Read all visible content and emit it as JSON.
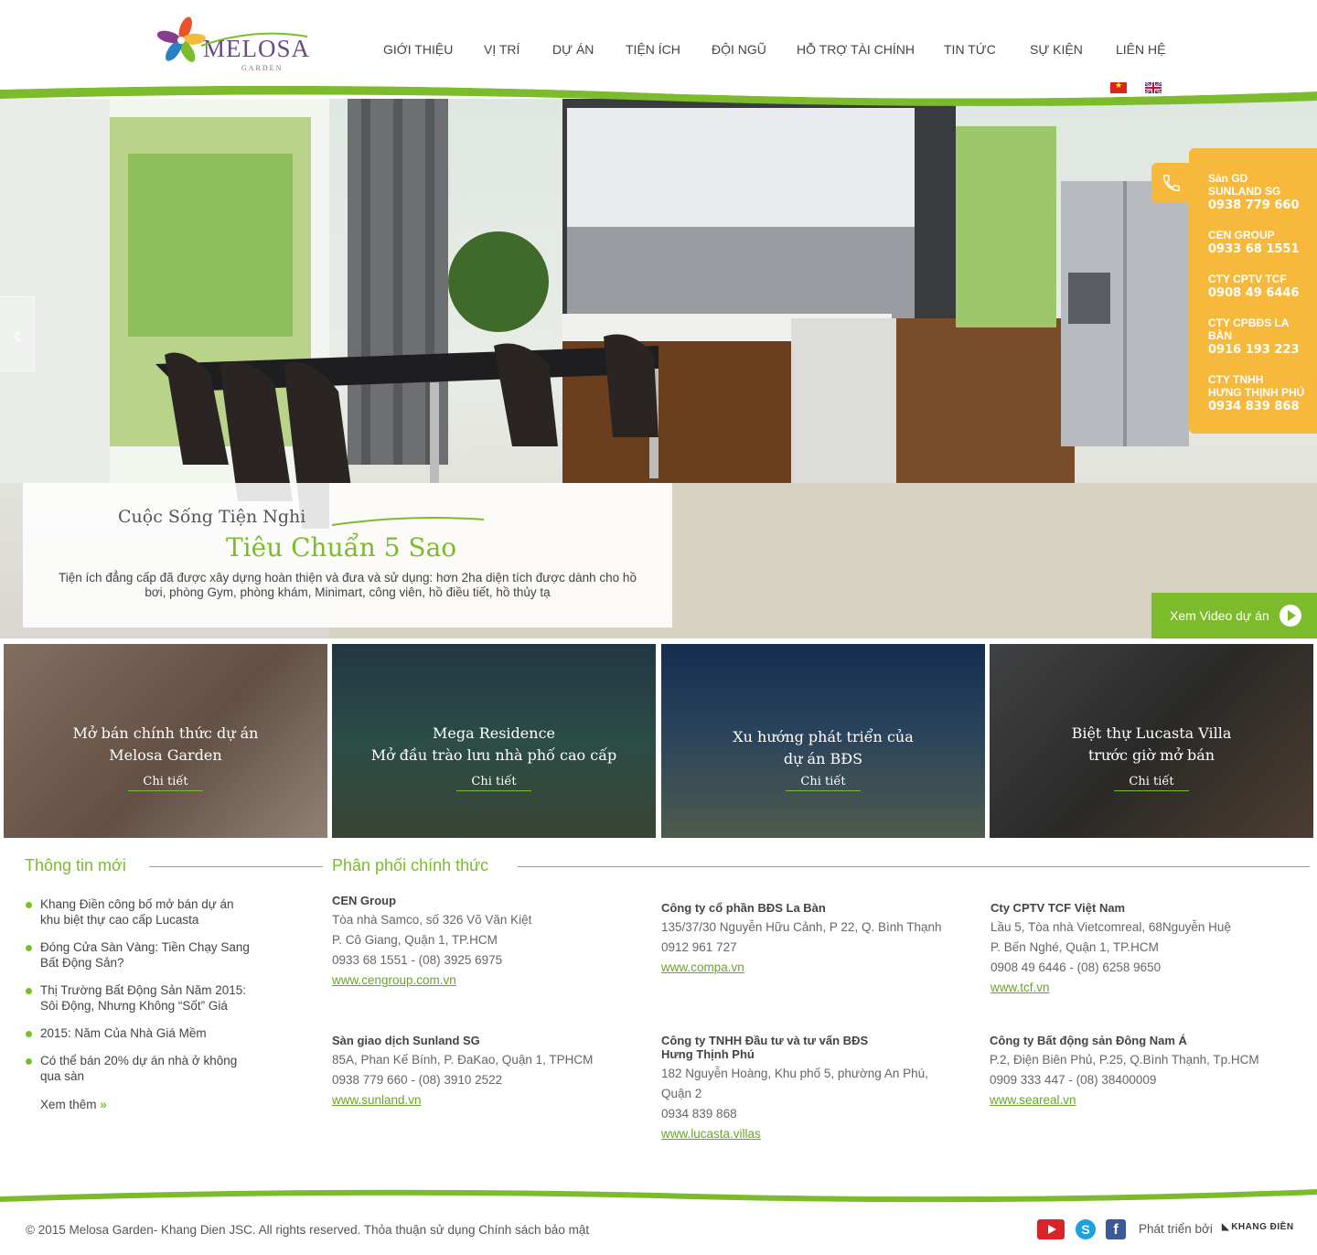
{
  "brand": {
    "name": "MELOSA",
    "sub": "GARDEN"
  },
  "nav": [
    {
      "label": "GIỚI THIỆU"
    },
    {
      "label": "VỊ TRÍ"
    },
    {
      "label": "DỰ ÁN"
    },
    {
      "label": "TIỆN ÍCH"
    },
    {
      "label": "ĐỘI NGŨ"
    },
    {
      "label": "HỖ TRỢ TÀI CHÍNH"
    },
    {
      "label": "TIN TỨC"
    },
    {
      "label": "SỰ KIỆN"
    },
    {
      "label": "LIÊN HỆ"
    }
  ],
  "hero": {
    "caption_line1": "Cuộc Sống Tiện Nghi",
    "caption_line2": "Tiêu Chuẩn 5 Sao",
    "caption_text": "Tiện ích đẳng cấp đã được xây dựng hoàn thiện và đưa và sử dụng: hơn 2ha diện tích được dành cho hồ bơi, phòng Gym, phòng khám, Minimart, công viên, hồ điều tiết, hồ thủy tạ",
    "video_label": "Xem Video dự án",
    "prev_arrow": "‹"
  },
  "contacts": [
    {
      "name": "Sàn GD",
      "name2": "SUNLAND SG",
      "phone": "0938 779 660"
    },
    {
      "name": "CEN GROUP",
      "name2": "",
      "phone": "0933 68 1551"
    },
    {
      "name": "CTY CPTV TCF",
      "name2": "",
      "phone": "0908 49 6446"
    },
    {
      "name": "CTY CPBĐS LA",
      "name2": "BÀN",
      "phone": "0916 193 223"
    },
    {
      "name": "CTY TNHH",
      "name2": "HƯNG THỊNH PHÚ",
      "phone": "0934 839 868"
    }
  ],
  "tiles": [
    {
      "line1": "Mở bán chính thức dự án",
      "line2": "Melosa Garden",
      "more": "Chi tiết"
    },
    {
      "line1": "Mega Residence",
      "line2": "Mở đầu trào lưu nhà phố cao cấp",
      "more": "Chi tiết"
    },
    {
      "line1": "Xu hướng phát triển của",
      "line2": "dự án BĐS",
      "more": "Chi tiết"
    },
    {
      "line1": "Biệt thự Lucasta Villa",
      "line2": "trước giờ mở bán",
      "more": "Chi tiết"
    }
  ],
  "news": {
    "title": "Thông tin mới",
    "items": [
      "Khang Điền công bố mở bán dự án khu biệt thự cao cấp Lucasta",
      "Đóng Cửa Sàn Vàng: Tiền Chạy Sang Bất Động Sản?",
      "Thị Trường Bất Động Sản Năm 2015: Sôi Động, Nhưng Không “Sốt” Giá",
      "2015: Năm Của Nhà Giá Mềm",
      "Có thể bán 20% dự án nhà ở không qua sàn"
    ],
    "more": "Xem thêm",
    "more_icon": "»"
  },
  "distributors": {
    "title": "Phân phối chính thức",
    "items": [
      {
        "name": "CEN Group",
        "lines": [
          "Tòa nhà Samco, số 326 Võ Văn Kiệt",
          "P. Cô Giang, Quận 1, TP.HCM",
          "0933 68 1551 - (08) 3925 6975"
        ],
        "link": "www.cengroup.com.vn"
      },
      {
        "name": "Công ty cổ phần BĐS La Bàn",
        "lines": [
          "135/37/30 Nguyễn Hữu Cảnh, P 22, Q. Bình Thạnh",
          "0912 961 727"
        ],
        "link": "www.compa.vn"
      },
      {
        "name": "Cty CPTV TCF Việt Nam",
        "lines": [
          "Lầu 5, Tòa nhà Vietcomreal, 68Nguyễn Huệ",
          "P. Bến Nghé, Quận 1, TP.HCM",
          "0908 49 6446 - (08) 6258 9650"
        ],
        "link": "www.tcf.vn"
      },
      {
        "name": "Sàn giao dịch Sunland SG",
        "lines": [
          "85A, Phan Kế Bính, P. ĐaKao, Quận 1, TPHCM",
          "0938 779 660 - (08) 3910 2522"
        ],
        "link": "www.sunland.vn"
      },
      {
        "name": "Công ty TNHH Đầu tư và tư vấn BĐS Hưng Thịnh Phú",
        "lines": [
          "182 Nguyễn Hoàng, Khu phố 5, phường An Phú, Quận 2",
          "0934 839 868"
        ],
        "link": "www.lucasta.villas"
      },
      {
        "name": "Công ty Bất động sản Đông Nam Á",
        "lines": [
          "P.2, Điện Biên Phủ, P.25, Q.Bình Thạnh, Tp.HCM",
          "0909 333 447 - (08) 38400009"
        ],
        "link": "www.seareal.vn"
      }
    ]
  },
  "footer": {
    "copyright": "© 2015 Melosa Garden- Khang Dien JSC. All rights reserved. Thỏa thuận sử dụng Chính sách bảo mật",
    "developed_by": "Phát triển bởi",
    "developer": "KHANG ĐIỀN",
    "skype": "S",
    "facebook": "f"
  },
  "icons": {
    "phone": "phone-icon",
    "play": "play-icon",
    "youtube": "youtube-icon",
    "skype": "skype-icon",
    "facebook": "facebook-icon"
  },
  "colors": {
    "accent": "#7cbb2c",
    "contact": "#f6b93b",
    "text": "#444444"
  }
}
